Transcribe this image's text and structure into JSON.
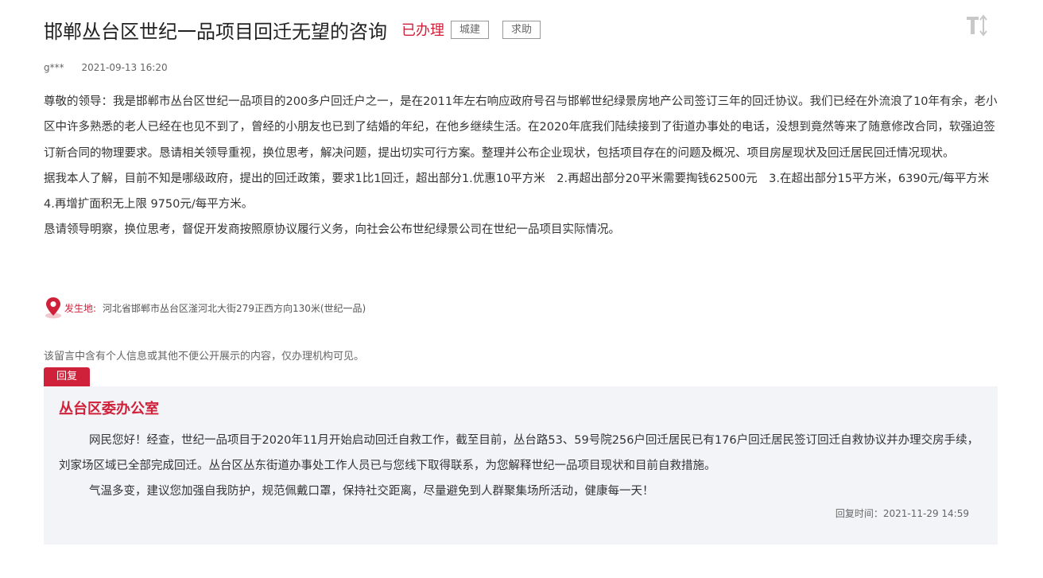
{
  "header": {
    "title": "邯郸丛台区世纪一品项目回迁无望的咨询",
    "status": "已办理",
    "tags": [
      "城建",
      "求助"
    ]
  },
  "meta": {
    "user": "g***",
    "time": "2021-09-13 16:20"
  },
  "content": {
    "paragraphs": [
      "尊敬的领导：我是邯郸市丛台区世纪一品项目的200多户回迁户之一，是在2011年左右响应政府号召与邯郸世纪绿景房地产公司签订三年的回迁协议。我们已经在外流浪了10年有余，老小区中许多熟悉的老人已经在也见不到了，曾经的小朋友也已到了结婚的年纪，在他乡继续生活。在2020年底我们陆续接到了街道办事处的电话，没想到竟然等来了随意修改合同，软强迫签订新合同的物理要求。恳请相关领导重视，换位思考，解决问题，提出切实可行方案。整理并公布企业现状，包括项目存在的问题及概况、项目房屋现状及回迁居民回迁情况现状。",
      "据我本人了解，目前不知是哪级政府，提出的回迁政策，要求1比1回迁，超出部分1.优惠10平方米　2.再超出部分20平米需要掏钱62500元　3.在超出部分15平方米，6390元/每平方米 4.再增扩面积无上限  9750元/每平方米。",
      "恳请领导明察，换位思考，督促开发商按照原协议履行义务，向社会公布世纪绿景公司在世纪一品项目实际情况。"
    ]
  },
  "location": {
    "label": "发生地:",
    "value": "河北省邯郸市丛台区滏河北大街279正西方向130米(世纪一品)"
  },
  "privacy_note": "该留言中含有个人信息或其他不便公开展示的内容，仅办理机构可见。",
  "reply": {
    "tab_label": "回复",
    "org": "丛台区委办公室",
    "paragraphs": [
      "网民您好！经查，世纪一品项目于2020年11月开始启动回迁自救工作，截至目前，丛台路53、59号院256户回迁居民已有176户回迁居民签订回迁自救协议并办理交房手续，刘家场区域已全部完成回迁。丛台区丛东街道办事处工作人员已与您线下取得联系，为您解释世纪一品项目现状和目前自救措施。",
      "气温多变，建议您加强自我防护，规范佩戴口罩，保持社交距离，尽量避免到人群聚集场所活动，健康每一天！"
    ],
    "time": "回复时间：2021-11-29 14:59"
  },
  "icons": {
    "font_size": "font-size-toggle-icon",
    "location": "location-pin-icon"
  },
  "colors": {
    "accent": "#d0213b",
    "reply_bg": "#f3f4f7"
  }
}
